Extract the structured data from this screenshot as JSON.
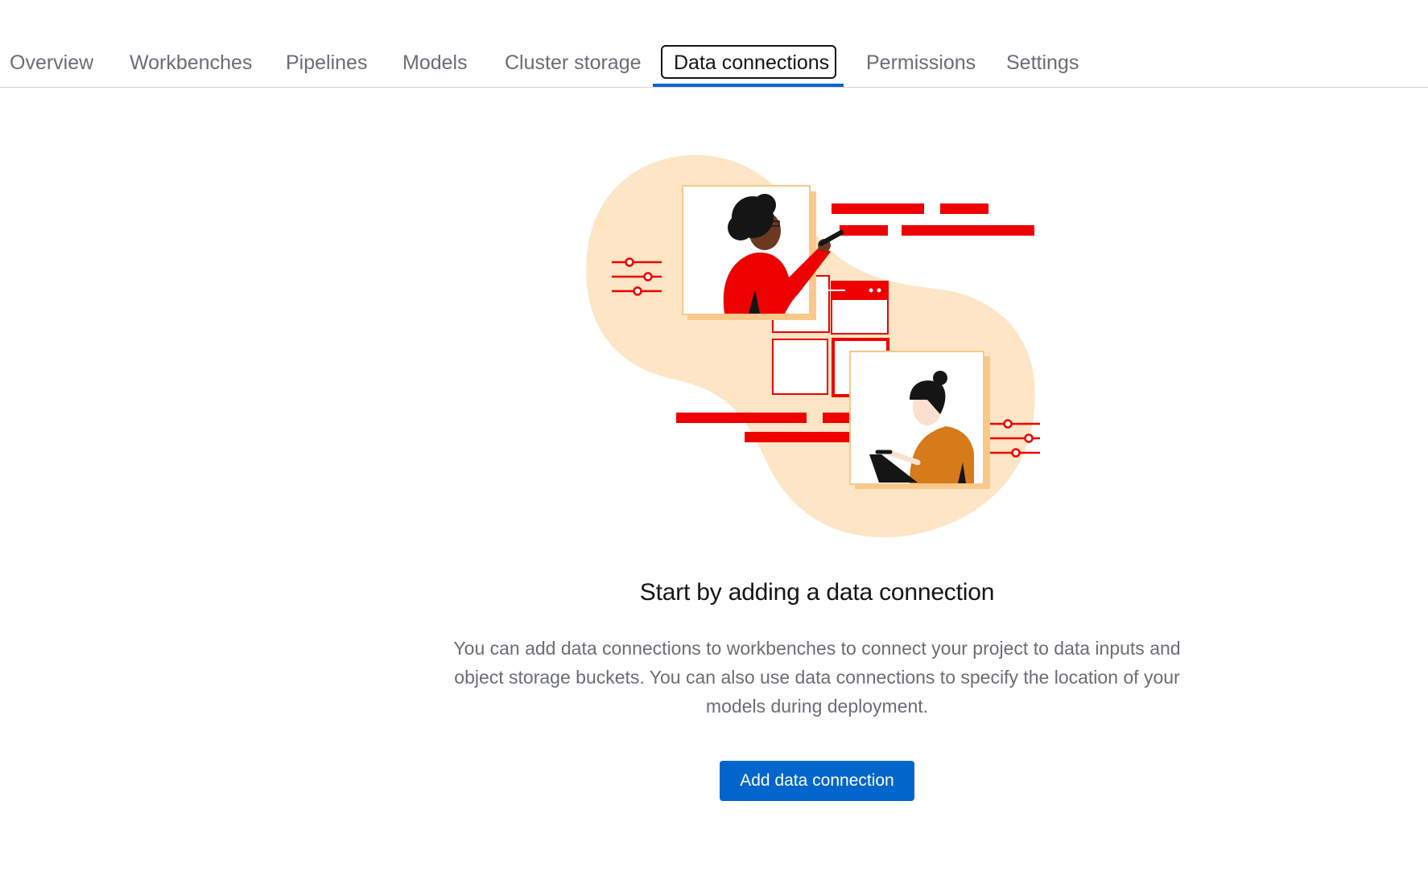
{
  "tabs": [
    {
      "label": "Overview",
      "active": false
    },
    {
      "label": "Workbenches",
      "active": false
    },
    {
      "label": "Pipelines",
      "active": false
    },
    {
      "label": "Models",
      "active": false
    },
    {
      "label": "Cluster storage",
      "active": false
    },
    {
      "label": "Data connections",
      "active": true
    },
    {
      "label": "Permissions",
      "active": false
    },
    {
      "label": "Settings",
      "active": false
    }
  ],
  "empty_state": {
    "illustration": "data-connection-illustration",
    "title": "Start by adding a data connection",
    "body": "You can add data connections to workbenches to connect your project to data inputs and object storage buckets. You can also use data connections to specify the location of your models during deployment.",
    "button_label": "Add data connection"
  },
  "colors": {
    "accent": "#0066cc",
    "illustration_red": "#ee0000",
    "illustration_peach": "#fde5c6"
  }
}
